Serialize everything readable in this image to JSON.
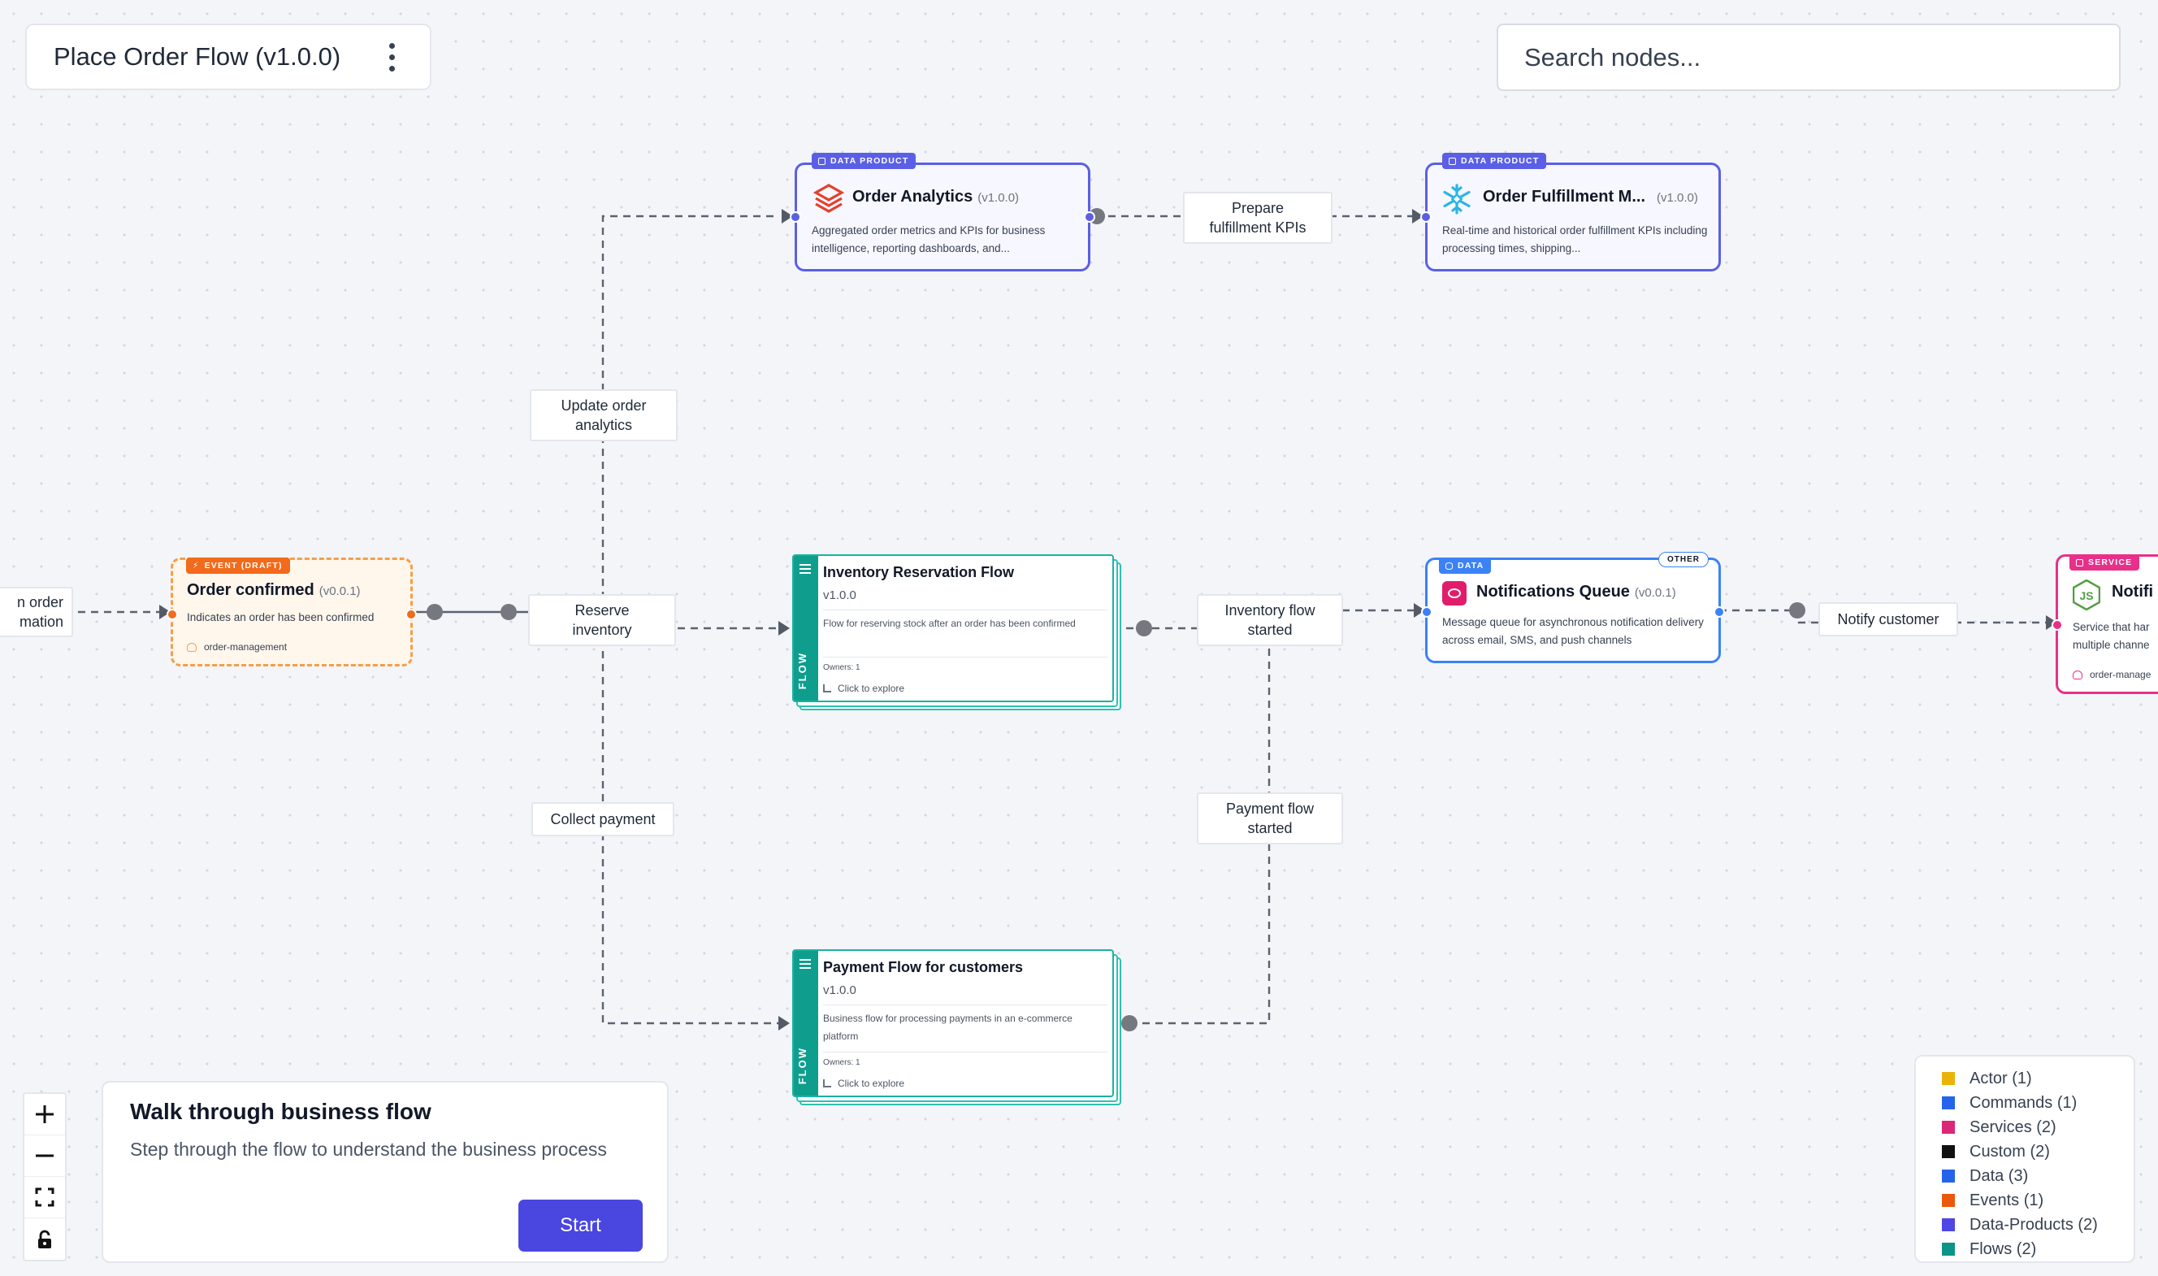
{
  "header": {
    "title": "Place Order Flow (v1.0.0)"
  },
  "search": {
    "placeholder": "Search nodes..."
  },
  "nodes": {
    "order_analytics": {
      "badge": "DATA PRODUCT",
      "name": "Order Analytics",
      "version": "(v1.0.0)",
      "description": "Aggregated order metrics and KPIs for business intelligence, reporting dashboards, and..."
    },
    "order_fulfillment": {
      "badge": "DATA PRODUCT",
      "name": "Order Fulfillment M...",
      "version": "(v1.0.0)",
      "description": "Real-time and historical order fulfillment KPIs including processing times, shipping..."
    },
    "order_confirmed": {
      "badge": "EVENT (DRAFT)",
      "name": "Order confirmed",
      "version": "(v0.0.1)",
      "description": "Indicates an order has been confirmed",
      "owner": "order-management"
    },
    "inventory_flow": {
      "name": "Inventory Reservation Flow",
      "version": "v1.0.0",
      "description": "Flow for reserving stock after an order has been confirmed",
      "owners": "Owners: 1",
      "explore": "Click to explore",
      "side": "FLOW"
    },
    "payment_flow": {
      "name": "Payment Flow for customers",
      "version": "v1.0.0",
      "description": "Business flow for processing payments in an e-commerce platform",
      "owners": "Owners: 1",
      "explore": "Click to explore",
      "side": "FLOW"
    },
    "notifications_queue": {
      "badge": "DATA",
      "tag": "OTHER",
      "name": "Notifications Queue",
      "version": "(v0.0.1)",
      "description": "Message queue for asynchronous notification delivery across email, SMS, and push channels"
    },
    "notification_service": {
      "badge": "SERVICE",
      "name": "Notifi",
      "description_lines": [
        "Service that har",
        "multiple channe"
      ],
      "owner": "order-manage"
    }
  },
  "edge_labels": {
    "left_partial": [
      "n order",
      "mation"
    ],
    "update_analytics": "Update order analytics",
    "prepare_kpis": "Prepare fulfillment KPIs",
    "reserve_inventory": "Reserve inventory",
    "inventory_started": "Inventory flow started",
    "notify_customer": "Notify customer",
    "collect_payment": "Collect payment",
    "payment_started": "Payment flow started"
  },
  "controls": {
    "zoom_in": "zoom-in",
    "zoom_out": "zoom-out",
    "fit_view": "fit-view",
    "lock": "lock"
  },
  "walkthrough": {
    "title": "Walk through business flow",
    "subtitle": "Step through the flow to understand the business process",
    "button": "Start"
  },
  "legend": [
    {
      "label": "Actor (1)",
      "color": "#eab308"
    },
    {
      "label": "Commands (1)",
      "color": "#2563eb"
    },
    {
      "label": "Services (2)",
      "color": "#db2777"
    },
    {
      "label": "Custom (2)",
      "color": "#111111"
    },
    {
      "label": "Data (3)",
      "color": "#2563eb"
    },
    {
      "label": "Events (1)",
      "color": "#ea580c"
    },
    {
      "label": "Data-Products (2)",
      "color": "#4f46e5"
    },
    {
      "label": "Flows (2)",
      "color": "#0d9488"
    }
  ]
}
